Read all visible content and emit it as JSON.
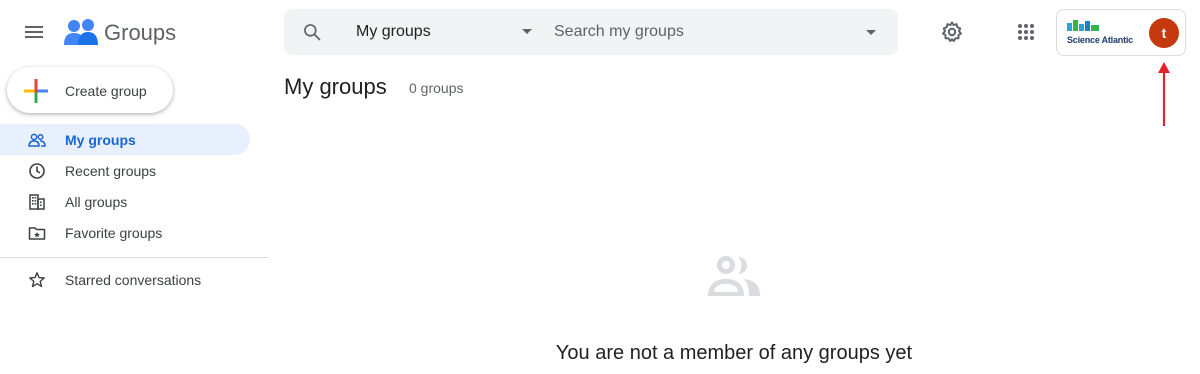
{
  "app": {
    "name": "Groups"
  },
  "header": {
    "search": {
      "scope": "My groups",
      "placeholder": "Search my groups"
    },
    "account": {
      "org_name": "Science Atlantic",
      "avatar_initial": "t",
      "avatar_color": "#c5390e"
    }
  },
  "sidebar": {
    "create_label": "Create group",
    "items": [
      {
        "label": "My groups",
        "icon": "people-icon",
        "active": true
      },
      {
        "label": "Recent groups",
        "icon": "clock-icon",
        "active": false
      },
      {
        "label": "All groups",
        "icon": "building-icon",
        "active": false
      },
      {
        "label": "Favorite groups",
        "icon": "folder-star-icon",
        "active": false
      }
    ],
    "secondary": [
      {
        "label": "Starred conversations",
        "icon": "star-icon"
      }
    ]
  },
  "main": {
    "title": "My groups",
    "count": "0 groups",
    "empty_message": "You are not a member of any groups yet"
  },
  "colors": {
    "accent": "#1967d2",
    "active_bg": "#e8f0fe",
    "annotation_arrow": "#e3232c"
  }
}
